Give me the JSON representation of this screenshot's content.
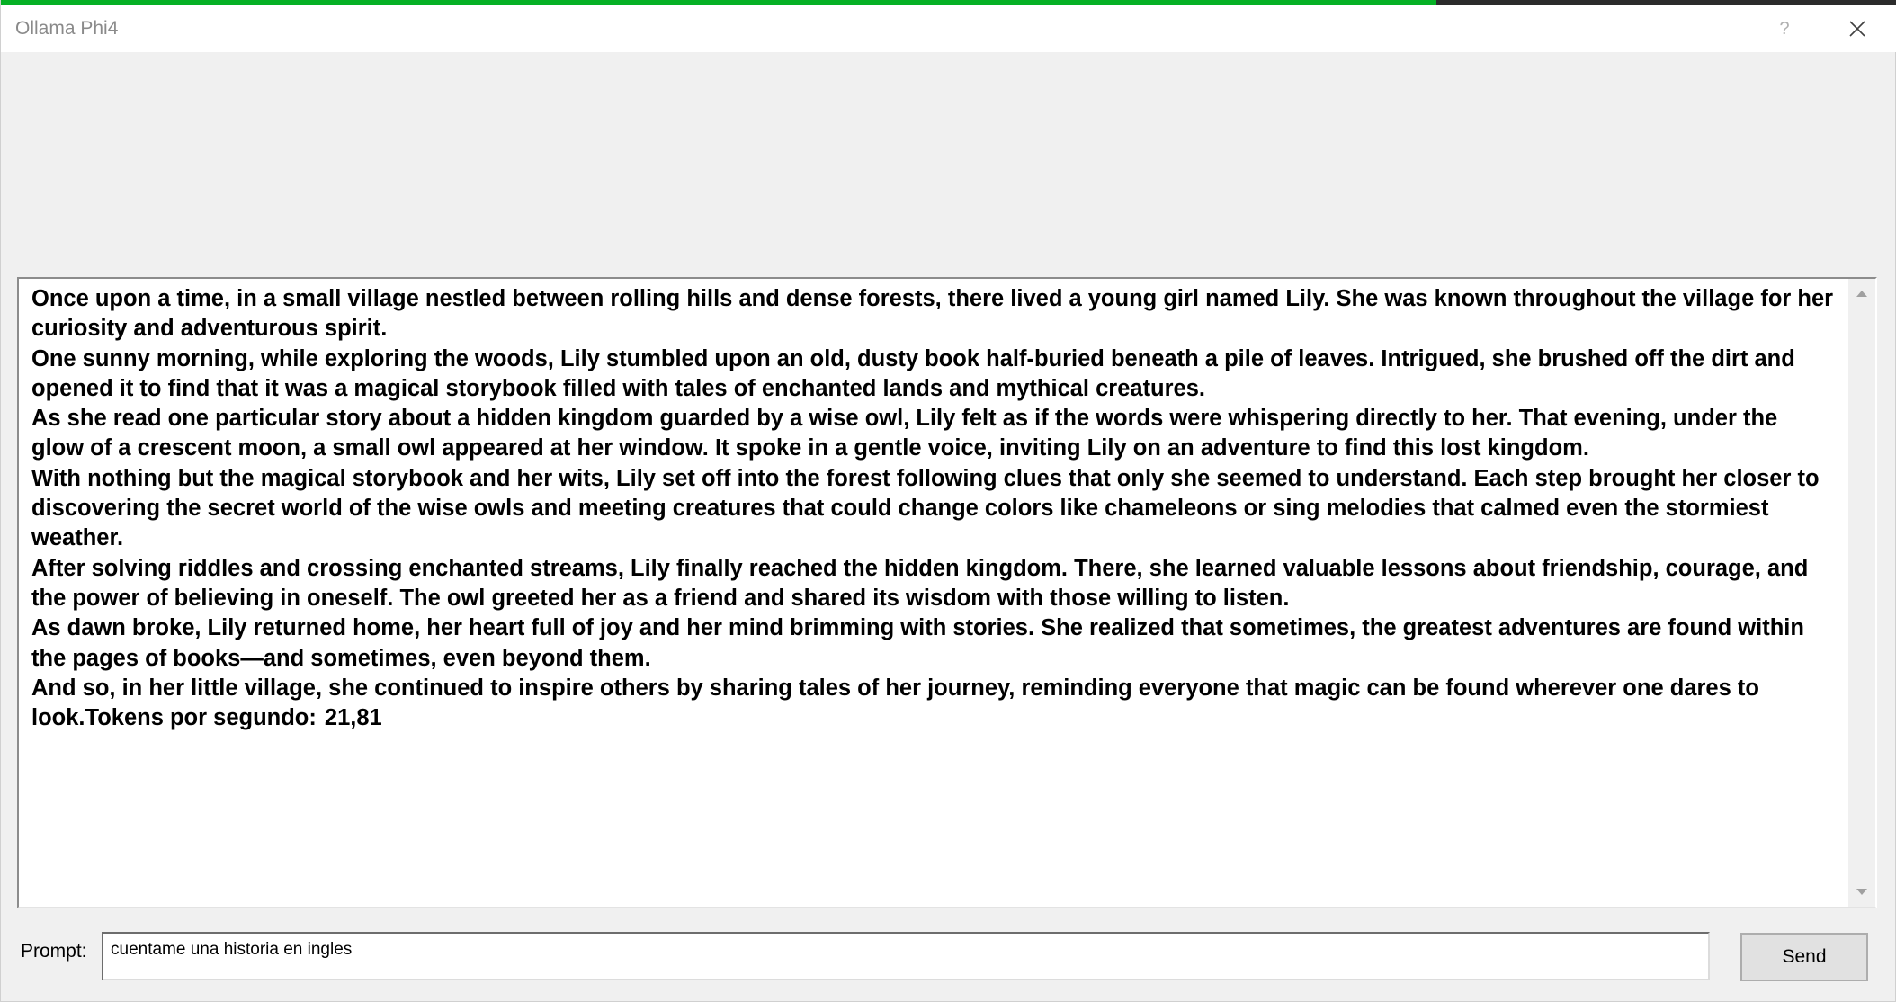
{
  "window": {
    "title": "Ollama Phi4",
    "help_label": "?",
    "progress_fraction": 0.757
  },
  "icons": {
    "close": "close-icon",
    "scroll_up": "scroll-up-arrow-icon",
    "scroll_down": "scroll-down-arrow-icon"
  },
  "colors": {
    "progress": "#06b025",
    "progress_track": "#2b2b2b"
  },
  "output": {
    "paragraphs": [
      "Once upon a time, in a small village nestled between rolling hills and dense forests, there lived a young girl named Lily. She was known throughout the village for her curiosity and adventurous spirit.",
      "One sunny morning, while exploring the woods, Lily stumbled upon an old, dusty book half-buried beneath a pile of leaves. Intrigued, she brushed off the dirt and opened it to find that it was a magical storybook filled with tales of enchanted lands and mythical creatures.",
      "As she read one particular story about a hidden kingdom guarded by a wise owl, Lily felt as if the words were whispering directly to her. That evening, under the glow of a crescent moon, a small owl appeared at her window. It spoke in a gentle voice, inviting Lily on an adventure to find this lost kingdom.",
      "With nothing but the magical storybook and her wits, Lily set off into the forest following clues that only she seemed to understand. Each step brought her closer to discovering the secret world of the wise owls and meeting creatures that could change colors like chameleons or sing melodies that calmed even the stormiest weather.",
      "After solving riddles and crossing enchanted streams, Lily finally reached the hidden kingdom. There, she learned valuable lessons about friendship, courage, and the power of believing in oneself. The owl greeted her as a friend and shared its wisdom with those willing to listen.",
      "As dawn broke, Lily returned home, her heart full of joy and her mind brimming with stories. She realized that sometimes, the greatest adventures are found within the pages of books—and sometimes, even beyond them.",
      "And so, in her little village, she continued to inspire others by sharing tales of her journey, reminding everyone that magic can be found wherever one dares to look.Tokens por segundo:\t21,81"
    ]
  },
  "prompt": {
    "label": "Prompt:",
    "value": "cuentame una historia en ingles"
  },
  "send_label": "Send"
}
